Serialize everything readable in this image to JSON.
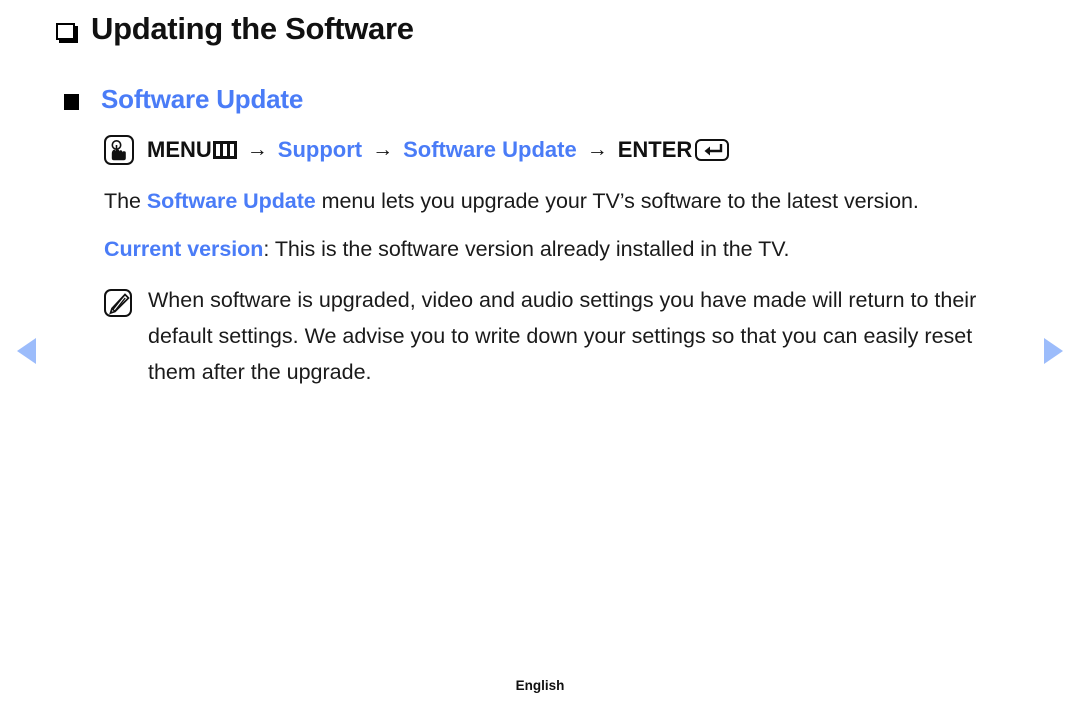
{
  "page": {
    "title": "Updating the Software",
    "subheading": "Software Update",
    "accent_color": "#4a7cf7",
    "arrow_color": "#9cbcfb",
    "text_color": "#1a1a1a"
  },
  "menu_path": {
    "press_icon": "hand-press-icon",
    "menu_label": "MENU",
    "menu_glyph": "menu-bars-icon",
    "arrow": "→",
    "step_support": "Support",
    "step_software_update": "Software Update",
    "enter_label": "ENTER",
    "enter_glyph": "enter-return-icon"
  },
  "paragraphs": {
    "intro_pre": "The ",
    "intro_highlight": "Software Update",
    "intro_post": " menu lets you upgrade your TV’s software to the latest version.",
    "current_version_label": "Current version",
    "current_version_text": ": This is the software version already installed in the TV."
  },
  "note": {
    "icon": "note-pencil-icon",
    "text": "When software is upgraded, video and audio settings you have made will return to their default settings. We advise you to write down your settings so that you can easily reset them after the upgrade."
  },
  "navigation": {
    "prev_icon": "previous-page-arrow",
    "next_icon": "next-page-arrow"
  },
  "footer": {
    "language": "English"
  }
}
